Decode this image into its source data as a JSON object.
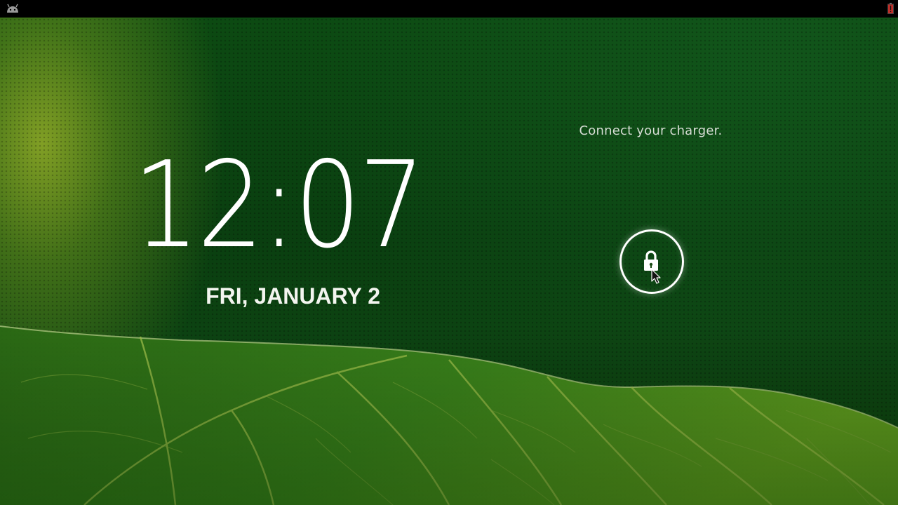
{
  "status_bar": {
    "left_icon": "android-icon",
    "right_icon": "battery-low-icon"
  },
  "lockscreen": {
    "message": "Connect your charger.",
    "time": "12:07",
    "date": "FRI, JANUARY 2",
    "unlock_icon": "lock-icon"
  },
  "colors": {
    "status_bar": "#000000",
    "wallpaper_green": "#0c4a12",
    "text": "#ffffff",
    "battery_warning": "#c0302a"
  }
}
